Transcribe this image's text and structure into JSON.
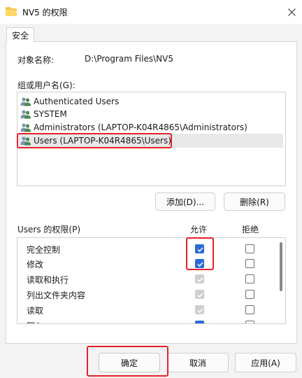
{
  "window": {
    "title": "NV5 的权限",
    "close_icon": "close-icon"
  },
  "tabs": [
    {
      "label": "安全"
    }
  ],
  "object": {
    "label": "对象名称:",
    "value": "D:\\Program Files\\NV5"
  },
  "groups": {
    "label": "组或用户名(G):",
    "items": [
      {
        "name": "Authenticated Users",
        "icon": "users-icon",
        "selected": false
      },
      {
        "name": "SYSTEM",
        "icon": "users-icon",
        "selected": false
      },
      {
        "name": "Administrators (LAPTOP-K04R4865\\Administrators)",
        "icon": "users-icon",
        "selected": false
      },
      {
        "name": "Users (LAPTOP-K04R4865\\Users)",
        "icon": "users-icon",
        "selected": true
      }
    ]
  },
  "buttons": {
    "add": "添加(D)...",
    "remove": "删除(R)",
    "ok": "确定",
    "cancel": "取消",
    "apply": "应用(A)"
  },
  "permissions": {
    "label": "Users 的权限(P)",
    "allow_header": "允许",
    "deny_header": "拒绝",
    "rows": [
      {
        "name": "完全控制",
        "allow": "checked",
        "deny": "empty"
      },
      {
        "name": "修改",
        "allow": "checked",
        "deny": "empty"
      },
      {
        "name": "读取和执行",
        "allow": "inherited",
        "deny": "empty"
      },
      {
        "name": "列出文件夹内容",
        "allow": "inherited",
        "deny": "empty"
      },
      {
        "name": "读取",
        "allow": "inherited",
        "deny": "empty"
      },
      {
        "name": "写入",
        "allow": "checked",
        "deny": "empty"
      }
    ]
  },
  "colors": {
    "highlight_red": "#e8202a",
    "check_blue": "#2b6ad8",
    "selected_row": "#e8e8e8"
  }
}
